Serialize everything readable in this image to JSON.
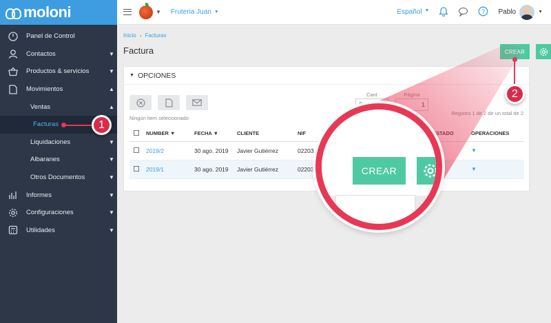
{
  "sidebar": {
    "logo": "moloni",
    "items": [
      {
        "label": "Panel de Control",
        "icon": "dashboard-icon",
        "chevron": ""
      },
      {
        "label": "Contactos",
        "icon": "user-icon",
        "chevron": "▼"
      },
      {
        "label": "Productos & servicios",
        "icon": "basket-icon",
        "chevron": "▼"
      },
      {
        "label": "Movimientos",
        "icon": "document-icon",
        "chevron": "▲"
      },
      {
        "label": "Ventas",
        "icon": "",
        "chevron": "▲"
      },
      {
        "label": "Facturas",
        "icon": "",
        "chevron": ""
      },
      {
        "label": "Liquidaciones",
        "icon": "",
        "chevron": "▼"
      },
      {
        "label": "Albaranes",
        "icon": "",
        "chevron": "▼"
      },
      {
        "label": "Otros Documentos",
        "icon": "",
        "chevron": "▼"
      },
      {
        "label": "Informes",
        "icon": "bar-chart-icon",
        "chevron": "▼"
      },
      {
        "label": "Configuraciones",
        "icon": "gear-icon",
        "chevron": "▼"
      },
      {
        "label": "Utilidades",
        "icon": "calculator-icon",
        "chevron": "▼"
      }
    ]
  },
  "topbar": {
    "store": "Fruteria Juan",
    "language": "Español",
    "user": "Pablo"
  },
  "breadcrumb": [
    "Inicio",
    "Facturas"
  ],
  "page_title": "Factura",
  "crear_label": "CREAR",
  "panel": {
    "title": "OPCIONES",
    "none_selected": "Ningún item seleccionado",
    "qty_label": "Cant",
    "qty_value": "20",
    "page_label": "Página",
    "page_value": "1",
    "records": "Registro 1 de 2 de un total de 2",
    "page_link": "1"
  },
  "table": {
    "headers": [
      "NUMBER",
      "FECHA",
      "CLIENTE",
      "NIF",
      "ESTADO",
      "OPERACIONES"
    ],
    "rows": [
      {
        "number": "2019/2",
        "date": "30 ago. 2019",
        "client": "Javier Gutiérrez",
        "nif": "02203",
        "status": "",
        "paid": false
      },
      {
        "number": "2019/1",
        "date": "30 ago. 2019",
        "client": "Javier Gutiérrez",
        "nif": "02203",
        "status": "",
        "paid": true
      }
    ]
  },
  "zoom": {
    "crear_label": "CREAR"
  },
  "markers": [
    "1",
    "2"
  ],
  "colors": {
    "accent": "#3d9de0",
    "green": "#4ec9a2",
    "marker": "#e73855",
    "sidebar": "#2d3748"
  }
}
